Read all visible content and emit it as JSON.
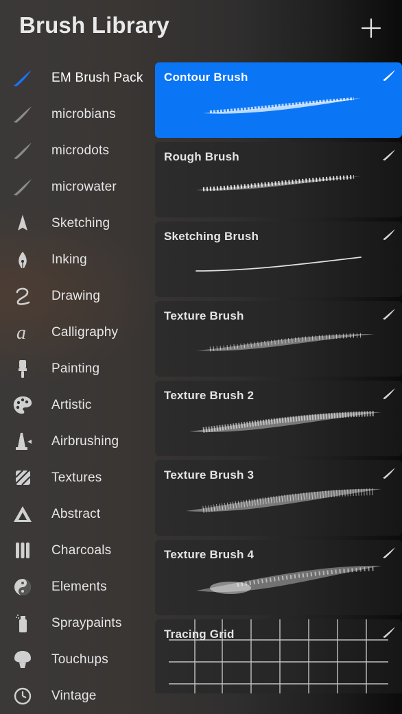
{
  "header": {
    "title": "Brush Library",
    "add_icon": "plus-icon"
  },
  "sidebar": {
    "items": [
      {
        "label": "EM Brush Pack",
        "icon": "brush-stroke-icon",
        "active": true
      },
      {
        "label": "microbians",
        "icon": "brush-stroke-icon"
      },
      {
        "label": "microdots",
        "icon": "brush-stroke-icon"
      },
      {
        "label": "microwater",
        "icon": "brush-stroke-icon"
      },
      {
        "label": "Sketching",
        "icon": "pencil-tip-icon"
      },
      {
        "label": "Inking",
        "icon": "pen-nib-icon"
      },
      {
        "label": "Drawing",
        "icon": "squiggle-icon"
      },
      {
        "label": "Calligraphy",
        "icon": "calligraphy-a-icon"
      },
      {
        "label": "Painting",
        "icon": "paint-brush-icon"
      },
      {
        "label": "Artistic",
        "icon": "palette-icon"
      },
      {
        "label": "Airbrushing",
        "icon": "airbrush-icon"
      },
      {
        "label": "Textures",
        "icon": "texture-icon"
      },
      {
        "label": "Abstract",
        "icon": "triangle-icon"
      },
      {
        "label": "Charcoals",
        "icon": "charcoal-sticks-icon"
      },
      {
        "label": "Elements",
        "icon": "yin-yang-icon"
      },
      {
        "label": "Spraypaints",
        "icon": "spray-can-icon"
      },
      {
        "label": "Touchups",
        "icon": "powder-brush-icon"
      },
      {
        "label": "Vintage",
        "icon": "clock-icon"
      }
    ]
  },
  "brushes": {
    "items": [
      {
        "name": "Contour Brush",
        "selected": true
      },
      {
        "name": "Rough Brush"
      },
      {
        "name": "Sketching Brush"
      },
      {
        "name": "Texture Brush"
      },
      {
        "name": "Texture Brush 2"
      },
      {
        "name": "Texture Brush 3"
      },
      {
        "name": "Texture Brush 4"
      },
      {
        "name": "Tracing Grid"
      }
    ]
  },
  "colors": {
    "accent": "#0a76f6",
    "active_icon": "#1a73f5",
    "background": "#2f2e2e",
    "card": "#262626"
  }
}
